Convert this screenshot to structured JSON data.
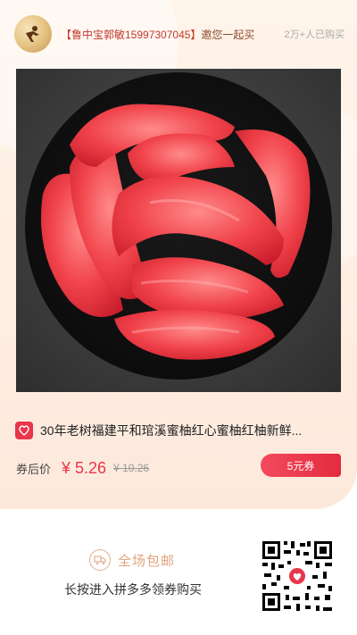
{
  "header": {
    "inviter_name": "【鲁中宝郭敏15997307045】",
    "invite_text": "邀您一起买",
    "buyers": "2万+人已购买"
  },
  "product": {
    "title": "30年老树福建平和琯溪蜜柚红心蜜柚红柚新鲜...",
    "price_label": "券后价",
    "price_now": "¥ 5.26",
    "price_old": "¥ 10.26",
    "coupon": "5元券",
    "image_icon": "pomelo-photo"
  },
  "footer": {
    "free_shipping": "全场包邮",
    "instruction": "长按进入拼多多领券购买",
    "qr_icon": "qr-code-icon"
  },
  "colors": {
    "accent": "#e8364a",
    "muted_gold": "#e3a37d",
    "background": "#fff4ea"
  }
}
